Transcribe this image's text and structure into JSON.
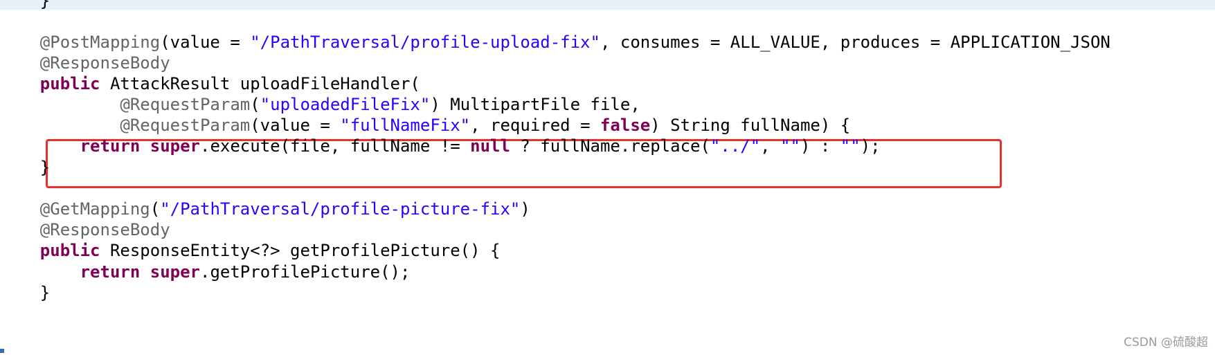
{
  "editor": {
    "lines": [
      {
        "id": "l0",
        "tokens": [
          {
            "t": "plain",
            "v": "    }"
          }
        ]
      },
      {
        "id": "l1",
        "tokens": []
      },
      {
        "id": "l2",
        "tokens": [
          {
            "t": "ann",
            "v": "    @PostMapping"
          },
          {
            "t": "plain",
            "v": "(value = "
          },
          {
            "t": "str",
            "v": "\"/PathTraversal/profile-upload-fix\""
          },
          {
            "t": "plain",
            "v": ", consumes = ALL_VALUE, produces = APPLICATION_JSON"
          }
        ]
      },
      {
        "id": "l3",
        "tokens": [
          {
            "t": "ann",
            "v": "    @ResponseBody"
          }
        ]
      },
      {
        "id": "l4",
        "tokens": [
          {
            "t": "kw",
            "v": "    public"
          },
          {
            "t": "plain",
            "v": " AttackResult uploadFileHandler("
          }
        ]
      },
      {
        "id": "l5",
        "tokens": [
          {
            "t": "ann",
            "v": "            @RequestParam"
          },
          {
            "t": "plain",
            "v": "("
          },
          {
            "t": "str",
            "v": "\"uploadedFileFix\""
          },
          {
            "t": "plain",
            "v": ") MultipartFile file,"
          }
        ]
      },
      {
        "id": "l6",
        "tokens": [
          {
            "t": "ann",
            "v": "            @RequestParam"
          },
          {
            "t": "plain",
            "v": "(value = "
          },
          {
            "t": "str",
            "v": "\"fullNameFix\""
          },
          {
            "t": "plain",
            "v": ", required = "
          },
          {
            "t": "kw",
            "v": "false"
          },
          {
            "t": "plain",
            "v": ") String fullName) {"
          }
        ]
      },
      {
        "id": "l7",
        "tokens": [
          {
            "t": "kw",
            "v": "        return"
          },
          {
            "t": "plain",
            "v": " "
          },
          {
            "t": "kw",
            "v": "super"
          },
          {
            "t": "plain",
            "v": ".execute(file, fullName != "
          },
          {
            "t": "kw",
            "v": "null"
          },
          {
            "t": "plain",
            "v": " ? fullName.replace("
          },
          {
            "t": "str",
            "v": "\"../\""
          },
          {
            "t": "plain",
            "v": ", "
          },
          {
            "t": "str",
            "v": "\"\""
          },
          {
            "t": "plain",
            "v": ") : "
          },
          {
            "t": "str",
            "v": "\"\""
          },
          {
            "t": "plain",
            "v": ");"
          }
        ]
      },
      {
        "id": "l8",
        "tokens": [
          {
            "t": "plain",
            "v": "    }"
          }
        ]
      },
      {
        "id": "l9",
        "tokens": []
      },
      {
        "id": "l10",
        "tokens": [
          {
            "t": "ann",
            "v": "    @GetMapping"
          },
          {
            "t": "plain",
            "v": "("
          },
          {
            "t": "str",
            "v": "\"/PathTraversal/profile-picture-fix\""
          },
          {
            "t": "plain",
            "v": ")"
          }
        ]
      },
      {
        "id": "l11",
        "tokens": [
          {
            "t": "ann",
            "v": "    @ResponseBody"
          }
        ]
      },
      {
        "id": "l12",
        "tokens": [
          {
            "t": "kw",
            "v": "    public"
          },
          {
            "t": "plain",
            "v": " ResponseEntity<?> getProfilePicture() {"
          }
        ]
      },
      {
        "id": "l13",
        "tokens": [
          {
            "t": "kw",
            "v": "        return"
          },
          {
            "t": "plain",
            "v": " "
          },
          {
            "t": "kw",
            "v": "super"
          },
          {
            "t": "plain",
            "v": ".getProfilePicture();"
          }
        ]
      },
      {
        "id": "l14",
        "tokens": [
          {
            "t": "plain",
            "v": "    }"
          }
        ]
      }
    ]
  },
  "watermark": {
    "text": "CSDN @硫酸超"
  },
  "colors": {
    "keyword": "#7f0055",
    "string": "#2a00ff",
    "annotation": "#646464",
    "highlight_border": "#e8302a"
  }
}
